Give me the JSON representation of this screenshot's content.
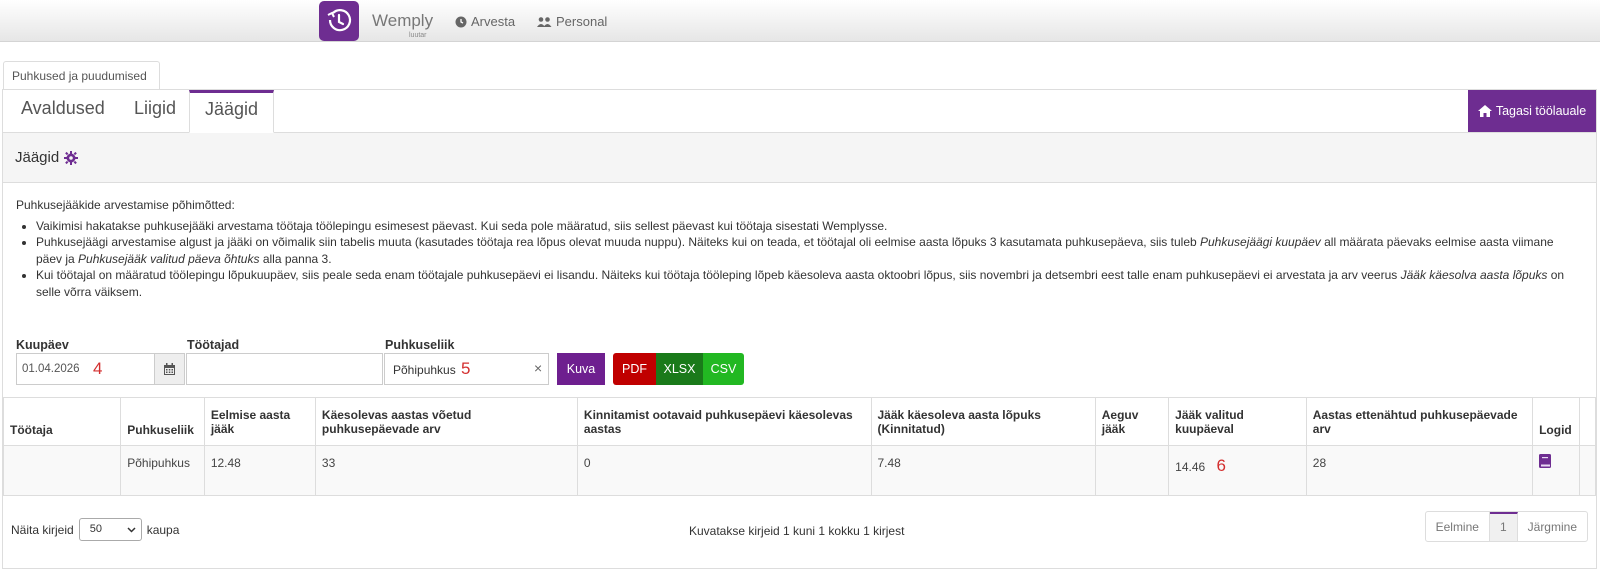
{
  "nav": {
    "brand": "Wemply",
    "brand_sub": "luutar",
    "links": [
      "Arvesta",
      "Personal"
    ]
  },
  "outer_tab": "Puhkused ja puudumised",
  "tabs": [
    "Avaldused",
    "Liigid",
    "Jäägid"
  ],
  "home_button": "Tagasi töölauale",
  "panel_title": "Jäägid",
  "description": {
    "intro": "Puhkusejääkide arvestamise põhimõtted:",
    "bullet1": "Vaikimisi hakatakse puhkusejääki arvestama töötaja töölepingu esimesest päevast. Kui seda pole määratud, siis sellest päevast kui töötaja sisestati Wemplysse.",
    "bullet2_a": "Puhkusejäägi arvestamise algust ja jääki on võimalik siin tabelis muuta (kasutades töötaja rea lõpus olevat muuda nuppu). Näiteks kui on teada, et töötajal oli eelmise aasta lõpuks 3 kasutamata puhkusepäeva, siis tuleb ",
    "bullet2_em1": "Puhkusejäägi kuupäev",
    "bullet2_b": " all määrata päevaks eelmise aasta viimane päev ja ",
    "bullet2_em2": "Puhkusejääk valitud päeva õhtuks",
    "bullet2_c": " alla panna 3.",
    "bullet3_a": "Kui töötajal on määratud töölepingu lõpukuupäev, siis peale seda enam töötajale puhkusepäevi ei lisandu. Näiteks kui töötaja tööleping lõpeb käesoleva aasta oktoobri lõpus, siis novembri ja detsembri eest talle enam puhkusepäevi ei arvestata ja arv veerus ",
    "bullet3_em": "Jääk käesolva aasta lõpuks",
    "bullet3_b": " on selle võrra väiksem."
  },
  "filters": {
    "date_label": "Kuupäev",
    "date_value": "01.04.2026",
    "employees_label": "Töötajad",
    "employees_value": "",
    "type_label": "Puhkuseliik",
    "type_value": "Põhipuhkus",
    "show_button": "Kuva",
    "pdf": "PDF",
    "xlsx": "XLSX",
    "csv": "CSV"
  },
  "annotations": [
    "4",
    "5",
    "6"
  ],
  "table": {
    "headers": [
      "Töötaja",
      "Puhkuseliik",
      "Eelmise aasta jääk",
      "Käesolevas aastas võetud puhkusepäevade arv",
      "Kinnitamist ootavaid puhkusepäevi käesolevas aastas",
      "Jääk käesoleva aasta lõpuks (Kinnitatud)",
      "Aeguv jääk",
      "Jääk valitud kuupäeval",
      "Aastas ettenähtud puhkusepäevade arv",
      "Logid"
    ],
    "row": [
      "",
      "Põhipuhkus",
      "12.48",
      "33",
      "0",
      "7.48",
      "",
      "14.46",
      "28"
    ]
  },
  "footer": {
    "show_label": "Näita kirjeid",
    "page_size": "50",
    "per": "kaupa",
    "info": "Kuvatakse kirjeid 1 kuni 1 kokku 1 kirjest",
    "prev": "Eelmine",
    "page": "1",
    "next": "Järgmine"
  },
  "colors": {
    "accent": "#6e2d91",
    "pdf": "#c00000",
    "xlsx": "#1a7a1a",
    "csv": "#22b822",
    "annotation": "#d32f2f"
  }
}
